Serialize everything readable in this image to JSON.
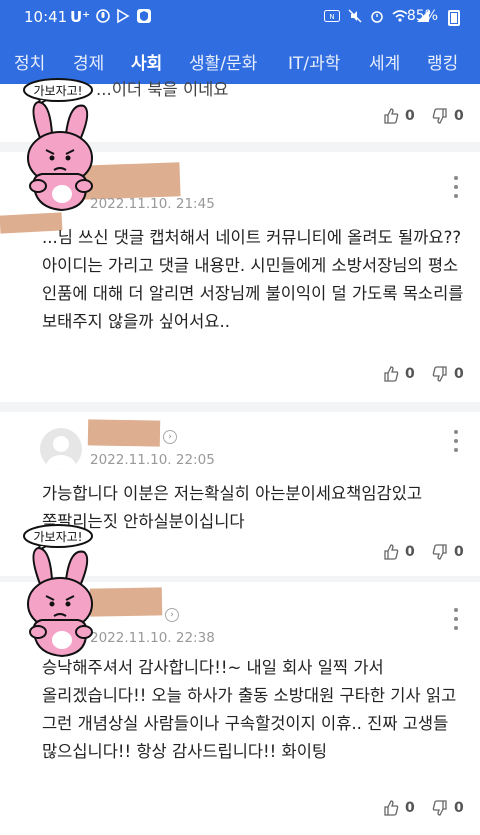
{
  "status_bar": {
    "time": "10:41",
    "carrier": "U⁺",
    "battery": "85%",
    "icons": [
      "voice-icon",
      "play-store-icon",
      "shield-app-icon",
      "nfc-icon",
      "mute-icon",
      "alarm-icon",
      "wifi-icon",
      "signal-icon",
      "battery-icon"
    ]
  },
  "nav": {
    "items": [
      "정치",
      "경제",
      "사회",
      "생활/문화",
      "IT/과학",
      "세계",
      "랭킹"
    ],
    "active": "사회"
  },
  "sticker_text": "가보자고!",
  "comments": [
    {
      "text": "...이더 북을 이네요",
      "likes": "0",
      "dislikes": "0"
    },
    {
      "date": "2022.11.10. 21:45",
      "text": "...님 쓰신 댓글 캡처해서 네이트 커뮤니티에 올려도 될까요?? 아이디는 가리고 댓글 내용만. 시민들에게 소방서장님의 평소 인품에 대해 더 알리면 서장님께 불이익이 덜 가도록 목소리를 보태주지 않을까 싶어서요..",
      "likes": "0",
      "dislikes": "0"
    },
    {
      "date": "2022.11.10. 22:05",
      "text": "가능합니다 이분은 저는확실히 아는분이세요책임감있고 쪽팔리는짓 안하실분이십니다",
      "likes": "0",
      "dislikes": "0"
    },
    {
      "date": "2022.11.10. 22:38",
      "text": "승낙해주셔서 감사합니다!!~ 내일 회사 일찍 가서 올리겠습니다!! 오늘 하사가 출동 소방대원 구타한 기사 읽고 그런 개념상실 사람들이나 구속할것이지 이휴.. 진짜 고생들 많으십니다!! 항상 감사드립니다!! 화이팅",
      "likes": "0",
      "dislikes": "0"
    }
  ],
  "colors": {
    "header_blue": "#2f6de1",
    "rabbit_pink": "#f4a3c7",
    "tape": "#d9a583"
  }
}
